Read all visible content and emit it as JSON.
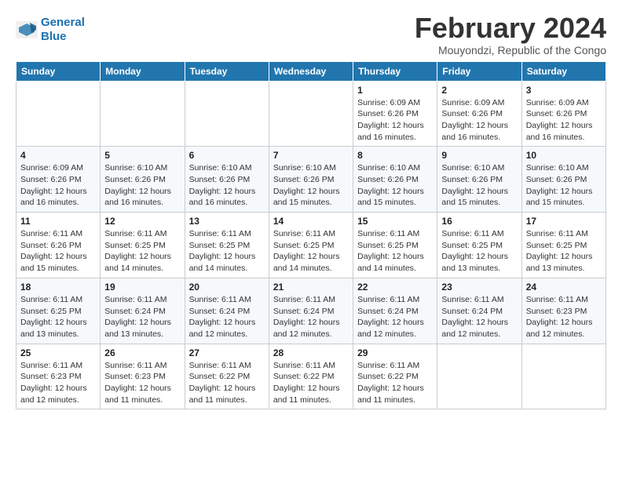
{
  "header": {
    "logo_line1": "General",
    "logo_line2": "Blue",
    "month_title": "February 2024",
    "location": "Mouyondzi, Republic of the Congo"
  },
  "weekdays": [
    "Sunday",
    "Monday",
    "Tuesday",
    "Wednesday",
    "Thursday",
    "Friday",
    "Saturday"
  ],
  "weeks": [
    [
      {
        "day": "",
        "info": ""
      },
      {
        "day": "",
        "info": ""
      },
      {
        "day": "",
        "info": ""
      },
      {
        "day": "",
        "info": ""
      },
      {
        "day": "1",
        "info": "Sunrise: 6:09 AM\nSunset: 6:26 PM\nDaylight: 12 hours\nand 16 minutes."
      },
      {
        "day": "2",
        "info": "Sunrise: 6:09 AM\nSunset: 6:26 PM\nDaylight: 12 hours\nand 16 minutes."
      },
      {
        "day": "3",
        "info": "Sunrise: 6:09 AM\nSunset: 6:26 PM\nDaylight: 12 hours\nand 16 minutes."
      }
    ],
    [
      {
        "day": "4",
        "info": "Sunrise: 6:09 AM\nSunset: 6:26 PM\nDaylight: 12 hours\nand 16 minutes."
      },
      {
        "day": "5",
        "info": "Sunrise: 6:10 AM\nSunset: 6:26 PM\nDaylight: 12 hours\nand 16 minutes."
      },
      {
        "day": "6",
        "info": "Sunrise: 6:10 AM\nSunset: 6:26 PM\nDaylight: 12 hours\nand 16 minutes."
      },
      {
        "day": "7",
        "info": "Sunrise: 6:10 AM\nSunset: 6:26 PM\nDaylight: 12 hours\nand 15 minutes."
      },
      {
        "day": "8",
        "info": "Sunrise: 6:10 AM\nSunset: 6:26 PM\nDaylight: 12 hours\nand 15 minutes."
      },
      {
        "day": "9",
        "info": "Sunrise: 6:10 AM\nSunset: 6:26 PM\nDaylight: 12 hours\nand 15 minutes."
      },
      {
        "day": "10",
        "info": "Sunrise: 6:10 AM\nSunset: 6:26 PM\nDaylight: 12 hours\nand 15 minutes."
      }
    ],
    [
      {
        "day": "11",
        "info": "Sunrise: 6:11 AM\nSunset: 6:26 PM\nDaylight: 12 hours\nand 15 minutes."
      },
      {
        "day": "12",
        "info": "Sunrise: 6:11 AM\nSunset: 6:25 PM\nDaylight: 12 hours\nand 14 minutes."
      },
      {
        "day": "13",
        "info": "Sunrise: 6:11 AM\nSunset: 6:25 PM\nDaylight: 12 hours\nand 14 minutes."
      },
      {
        "day": "14",
        "info": "Sunrise: 6:11 AM\nSunset: 6:25 PM\nDaylight: 12 hours\nand 14 minutes."
      },
      {
        "day": "15",
        "info": "Sunrise: 6:11 AM\nSunset: 6:25 PM\nDaylight: 12 hours\nand 14 minutes."
      },
      {
        "day": "16",
        "info": "Sunrise: 6:11 AM\nSunset: 6:25 PM\nDaylight: 12 hours\nand 13 minutes."
      },
      {
        "day": "17",
        "info": "Sunrise: 6:11 AM\nSunset: 6:25 PM\nDaylight: 12 hours\nand 13 minutes."
      }
    ],
    [
      {
        "day": "18",
        "info": "Sunrise: 6:11 AM\nSunset: 6:25 PM\nDaylight: 12 hours\nand 13 minutes."
      },
      {
        "day": "19",
        "info": "Sunrise: 6:11 AM\nSunset: 6:24 PM\nDaylight: 12 hours\nand 13 minutes."
      },
      {
        "day": "20",
        "info": "Sunrise: 6:11 AM\nSunset: 6:24 PM\nDaylight: 12 hours\nand 12 minutes."
      },
      {
        "day": "21",
        "info": "Sunrise: 6:11 AM\nSunset: 6:24 PM\nDaylight: 12 hours\nand 12 minutes."
      },
      {
        "day": "22",
        "info": "Sunrise: 6:11 AM\nSunset: 6:24 PM\nDaylight: 12 hours\nand 12 minutes."
      },
      {
        "day": "23",
        "info": "Sunrise: 6:11 AM\nSunset: 6:24 PM\nDaylight: 12 hours\nand 12 minutes."
      },
      {
        "day": "24",
        "info": "Sunrise: 6:11 AM\nSunset: 6:23 PM\nDaylight: 12 hours\nand 12 minutes."
      }
    ],
    [
      {
        "day": "25",
        "info": "Sunrise: 6:11 AM\nSunset: 6:23 PM\nDaylight: 12 hours\nand 12 minutes."
      },
      {
        "day": "26",
        "info": "Sunrise: 6:11 AM\nSunset: 6:23 PM\nDaylight: 12 hours\nand 11 minutes."
      },
      {
        "day": "27",
        "info": "Sunrise: 6:11 AM\nSunset: 6:22 PM\nDaylight: 12 hours\nand 11 minutes."
      },
      {
        "day": "28",
        "info": "Sunrise: 6:11 AM\nSunset: 6:22 PM\nDaylight: 12 hours\nand 11 minutes."
      },
      {
        "day": "29",
        "info": "Sunrise: 6:11 AM\nSunset: 6:22 PM\nDaylight: 12 hours\nand 11 minutes."
      },
      {
        "day": "",
        "info": ""
      },
      {
        "day": "",
        "info": ""
      }
    ]
  ]
}
